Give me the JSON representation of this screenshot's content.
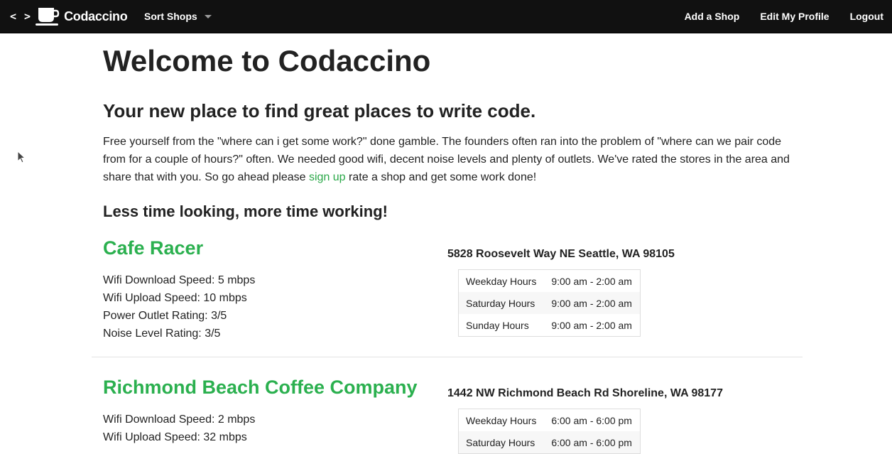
{
  "navbar": {
    "brand_code": "< >",
    "brand_name": "Codaccino",
    "sort_label": "Sort Shops",
    "links": [
      "Add a Shop",
      "Edit My Profile",
      "Logout"
    ]
  },
  "page": {
    "title": "Welcome to Codaccino",
    "subtitle": "Your new place to find great places to write code.",
    "intro_before": "Free yourself from the \"where can i get some work?\" done gamble. The founders often ran into the problem of \"where can we pair code from for a couple of hours?\" often. We needed good wifi, decent noise levels and plenty of outlets. We've rated the stores in the area and share that with you. So go ahead please ",
    "intro_link": "sign up",
    "intro_after": " rate a shop and get some work done!",
    "section_heading": "Less time looking, more time working!"
  },
  "shops": [
    {
      "name": "Cafe Racer",
      "address": "5828 Roosevelt Way NE Seattle, WA 98105",
      "stats": [
        "Wifi Download Speed: 5 mbps",
        "Wifi Upload Speed: 10 mbps",
        "Power Outlet Rating: 3/5",
        "Noise Level Rating: 3/5"
      ],
      "hours": [
        {
          "label": "Weekday Hours",
          "value": "9:00 am - 2:00 am"
        },
        {
          "label": "Saturday Hours",
          "value": "9:00 am - 2:00 am"
        },
        {
          "label": "Sunday Hours",
          "value": "9:00 am - 2:00 am"
        }
      ]
    },
    {
      "name": "Richmond Beach Coffee Company",
      "address": "1442 NW Richmond Beach Rd Shoreline, WA 98177",
      "stats": [
        "Wifi Download Speed: 2 mbps",
        "Wifi Upload Speed: 32 mbps"
      ],
      "hours": [
        {
          "label": "Weekday Hours",
          "value": "6:00 am - 6:00 pm"
        },
        {
          "label": "Saturday Hours",
          "value": "6:00 am - 6:00 pm"
        }
      ]
    }
  ],
  "colors": {
    "navbar_bg": "#111111",
    "accent_green": "#2bb04f",
    "text": "#222222"
  },
  "icons": {
    "brand": [
      "code-icon",
      "coffee-cup-icon"
    ],
    "dropdown": "caret-down-icon",
    "pointer": "mouse-cursor-icon"
  }
}
